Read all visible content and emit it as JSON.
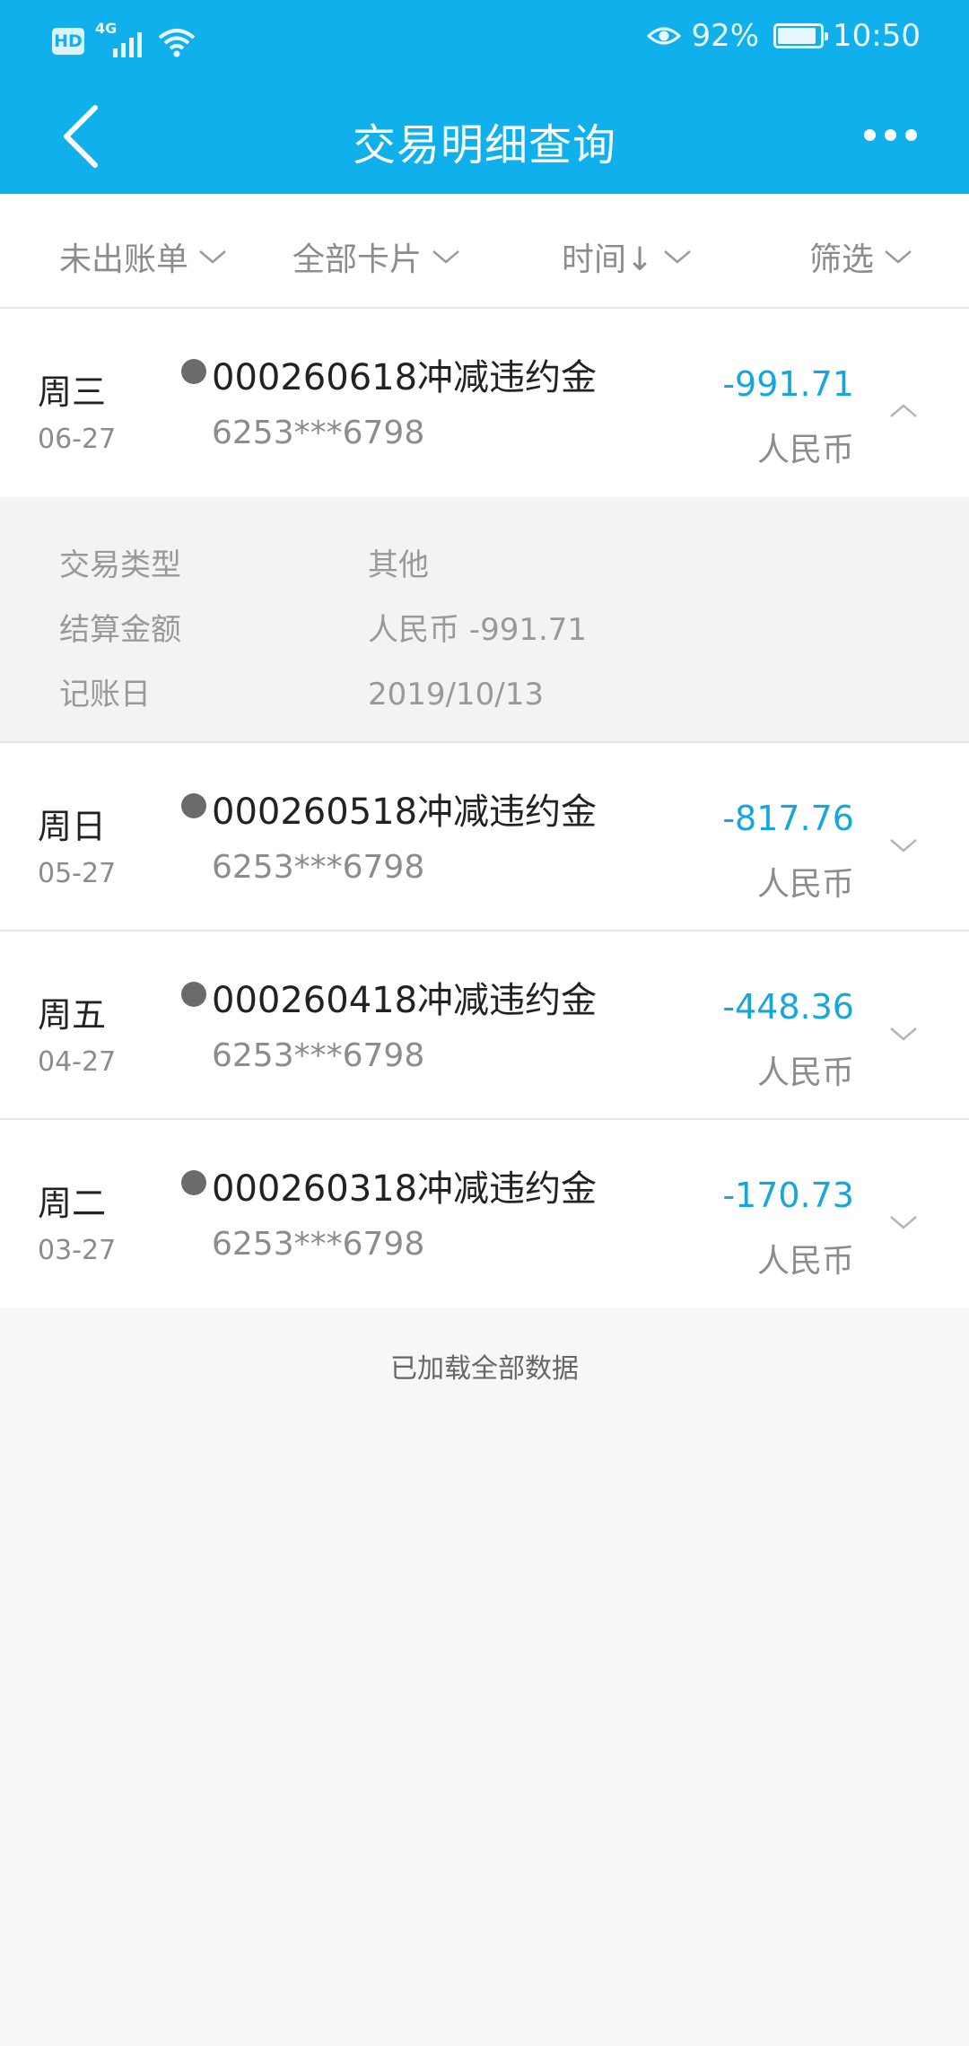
{
  "status_bar": {
    "hd": "HD",
    "network": "4G",
    "battery_percent": "92%",
    "battery_level": 0.92,
    "time": "10:50"
  },
  "header": {
    "title": "交易明细查询",
    "background_color": "#0fb0ec"
  },
  "filters": [
    {
      "label": "未出账单"
    },
    {
      "label": "全部卡片"
    },
    {
      "label": "时间↓"
    },
    {
      "label": "筛选"
    }
  ],
  "transactions": [
    {
      "day": "周三",
      "date": "06-27",
      "title": "000260618冲减违约金",
      "card": "6253***6798",
      "amount": "-991.71",
      "currency": "人民币",
      "expanded": true,
      "details": [
        {
          "label": "交易类型",
          "value": "其他"
        },
        {
          "label": "结算金额",
          "value": "人民币 -991.71"
        },
        {
          "label": "记账日",
          "value": "2019/10/13"
        }
      ]
    },
    {
      "day": "周日",
      "date": "05-27",
      "title": "000260518冲减违约金",
      "card": "6253***6798",
      "amount": "-817.76",
      "currency": "人民币",
      "expanded": false
    },
    {
      "day": "周五",
      "date": "04-27",
      "title": "000260418冲减违约金",
      "card": "6253***6798",
      "amount": "-448.36",
      "currency": "人民币",
      "expanded": false
    },
    {
      "day": "周二",
      "date": "03-27",
      "title": "000260318冲减违约金",
      "card": "6253***6798",
      "amount": "-170.73",
      "currency": "人民币",
      "expanded": false
    }
  ],
  "footer": {
    "note": "已加载全部数据"
  },
  "colors": {
    "accent": "#0fb0ec",
    "amount": "#16a6de"
  }
}
